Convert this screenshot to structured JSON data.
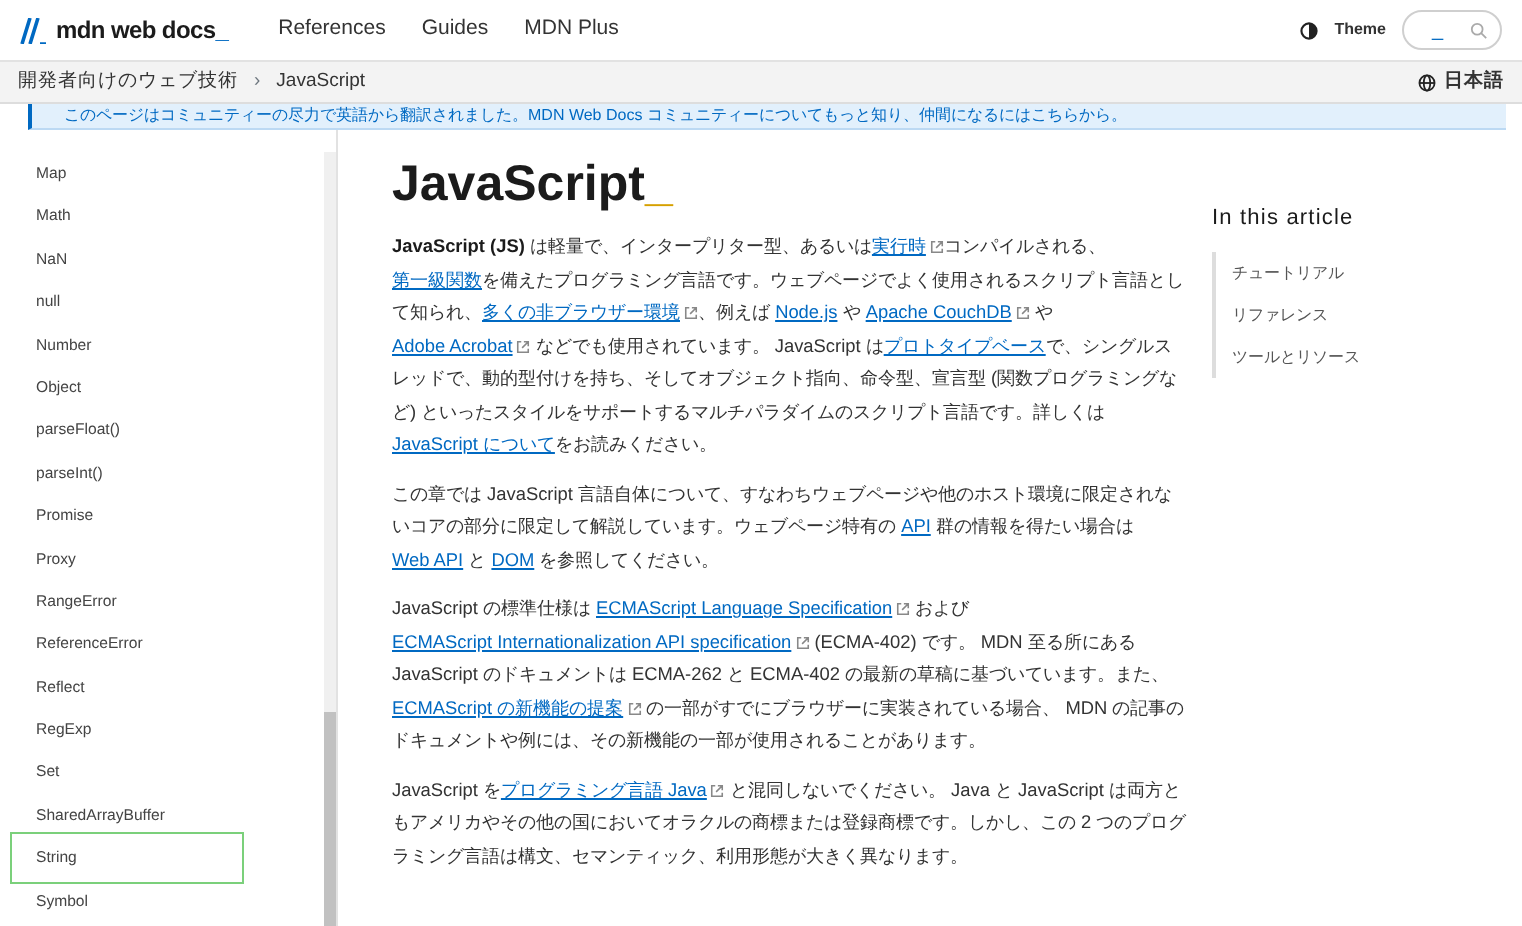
{
  "header": {
    "logo": "mdn web docs",
    "logo_cursor": "_",
    "nav": [
      "References",
      "Guides",
      "MDN Plus"
    ],
    "theme": "Theme",
    "search": {
      "value": "_"
    }
  },
  "breadcrumb": {
    "items": [
      "開発者向けのウェブ技術",
      "JavaScript"
    ],
    "separator": "›",
    "language": "日本語"
  },
  "banner": {
    "text": "このページはコミュニティーの尽力で英語から翻訳されました。MDN Web Docs コミュニティーについてもっと知り、仲間になるにはこちらから。"
  },
  "sidebar": {
    "items": [
      {
        "label": "Map",
        "selected": false
      },
      {
        "label": "Math",
        "selected": false
      },
      {
        "label": "NaN",
        "selected": false
      },
      {
        "label": "null",
        "selected": false
      },
      {
        "label": "Number",
        "selected": false
      },
      {
        "label": "Object",
        "selected": false
      },
      {
        "label": "parseFloat()",
        "selected": false
      },
      {
        "label": "parseInt()",
        "selected": false
      },
      {
        "label": "Promise",
        "selected": false
      },
      {
        "label": "Proxy",
        "selected": false
      },
      {
        "label": "RangeError",
        "selected": false
      },
      {
        "label": "ReferenceError",
        "selected": false
      },
      {
        "label": "Reflect",
        "selected": false
      },
      {
        "label": "RegExp",
        "selected": false
      },
      {
        "label": "Set",
        "selected": false
      },
      {
        "label": "SharedArrayBuffer",
        "selected": false
      },
      {
        "label": "String",
        "selected": true
      },
      {
        "label": "Symbol",
        "selected": false
      }
    ]
  },
  "article": {
    "title": "JavaScript",
    "title_cursor": "_",
    "paragraphs": [
      [
        {
          "kind": "text",
          "text": "**JavaScript (JS)** は軽量で、インタープリター型、あるいは"
        },
        {
          "kind": "extlink",
          "text": "実行時"
        },
        {
          "kind": "text",
          "text": "コンパイルされる、"
        },
        {
          "kind": "link",
          "text": "第一級関数"
        },
        {
          "kind": "text",
          "text": "を備えたプログラミング言語です。ウェブページでよく使用されるスクリプト言語として知られ、"
        },
        {
          "kind": "extlink",
          "text": "多くの非ブラウザー環境"
        },
        {
          "kind": "text",
          "text": "、例えば "
        },
        {
          "kind": "link",
          "text": "Node.js"
        },
        {
          "kind": "text",
          "text": " や "
        },
        {
          "kind": "extlink",
          "text": "Apache CouchDB"
        },
        {
          "kind": "text",
          "text": " や "
        },
        {
          "kind": "extlink",
          "text": "Adobe Acrobat"
        },
        {
          "kind": "text",
          "text": " などでも使用されています。 JavaScript は"
        },
        {
          "kind": "link",
          "text": "プロトタイプベース"
        },
        {
          "kind": "text",
          "text": "で、シングルスレッドで、動的型付けを持ち、そしてオブジェクト指向、命令型、宣言型 (関数プログラミングなど) といったスタイルをサポートするマルチパラダイムのスクリプト言語です。詳しくは "
        },
        {
          "kind": "link",
          "text": "JavaScript について"
        },
        {
          "kind": "text",
          "text": "をお読みください。"
        }
      ],
      [
        {
          "kind": "text",
          "text": "この章では JavaScript 言語自体について、すなわちウェブページや他のホスト環境に限定されないコアの部分に限定して解説しています。ウェブページ特有の "
        },
        {
          "kind": "link",
          "text": "API"
        },
        {
          "kind": "text",
          "text": " 群の情報を得たい場合は "
        },
        {
          "kind": "link",
          "text": "Web API"
        },
        {
          "kind": "text",
          "text": " と "
        },
        {
          "kind": "link",
          "text": "DOM"
        },
        {
          "kind": "text",
          "text": " を参照してください。"
        }
      ],
      [
        {
          "kind": "text",
          "text": "JavaScript の標準仕様は "
        },
        {
          "kind": "extlink",
          "text": "ECMAScript Language Specification"
        },
        {
          "kind": "text",
          "text": " および "
        },
        {
          "kind": "extlink",
          "text": "ECMAScript Internationalization API specification"
        },
        {
          "kind": "text",
          "text": " (ECMA-402) です。 MDN 至る所にある JavaScript のドキュメントは ECMA-262 と ECMA-402 の最新の草稿に基づいています。また、 "
        },
        {
          "kind": "extlink",
          "text": "ECMAScript の新機能の提案"
        },
        {
          "kind": "text",
          "text": " の一部がすでにブラウザーに実装されている場合、 MDN の記事のドキュメントや例には、その新機能の一部が使用されることがあります。"
        }
      ],
      [
        {
          "kind": "text",
          "text": "JavaScript を"
        },
        {
          "kind": "extlink",
          "text": "プログラミング言語 Java"
        },
        {
          "kind": "text",
          "text": " と混同しないでください。 Java と JavaScript は両方ともアメリカやその他の国においてオラクルの商標または登録商標です。しかし、この 2 つのプログラミング言語は構文、セマンティック、利用形態が大きく異なります。"
        }
      ]
    ]
  },
  "toc": {
    "title": "In this article",
    "items": [
      "チュートリアル",
      "リファレンス",
      "ツールとリソース"
    ]
  }
}
